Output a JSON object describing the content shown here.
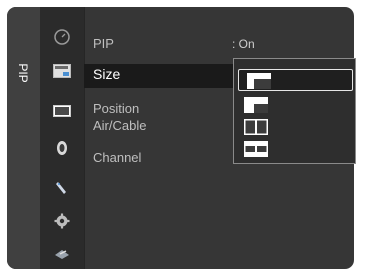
{
  "menu": {
    "title": "PIP",
    "items": [
      {
        "label": "PIP",
        "value": ": On"
      },
      {
        "label": "Size",
        "value": ":"
      },
      {
        "label": "Position",
        "value": ":"
      },
      {
        "label": "Air/Cable",
        "value": ":"
      },
      {
        "label": "Channel",
        "value": ":"
      }
    ],
    "selected_item": "Size"
  },
  "side_icons": [
    "clock-icon",
    "pip-icon",
    "screen-icon",
    "sound-icon",
    "remote-icon",
    "settings-gear-icon",
    "input-icon"
  ],
  "size_options": [
    "large-inset-size-icon",
    "small-inset-size-icon",
    "double-split-size-icon",
    "double-split-wide-size-icon"
  ],
  "selected_option_index": 0,
  "colors": {
    "panel": "#363636",
    "icon_column": "#2b2b2b",
    "highlight": "#1a1a1a",
    "text": "#ffffff"
  }
}
